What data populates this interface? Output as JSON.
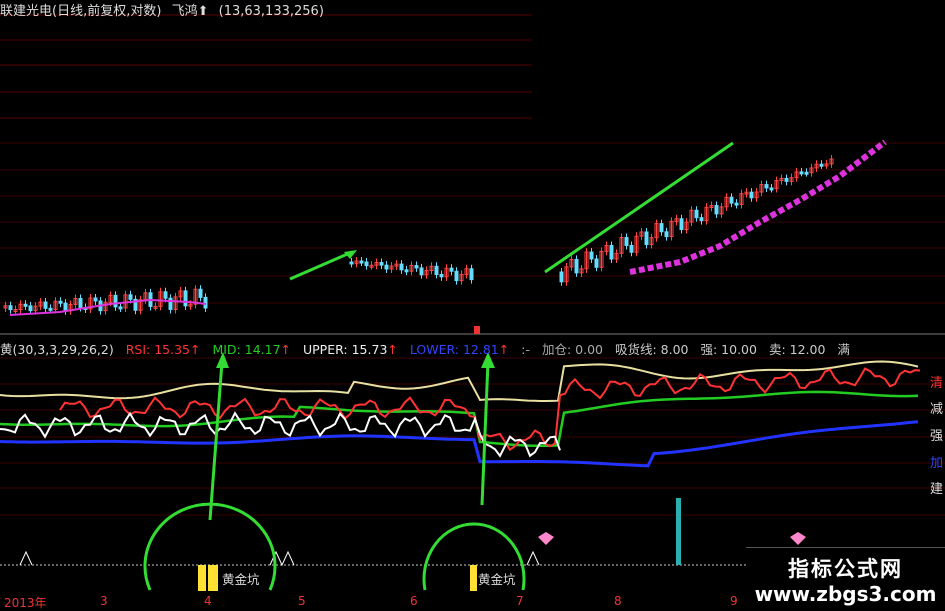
{
  "header": {
    "stock": "联建光电",
    "period": "(日线,前复权,对数)",
    "indicator": "飞鸿",
    "params": "(13,63,133,256)"
  },
  "indicator_bar": {
    "name": "黄",
    "params": "(30,3,3,29,26,2)",
    "rsi": "RSI: 15.35",
    "mid": "MID: 14.17",
    "upper": "UPPER: 15.73",
    "lower": "LOWER: 12.81",
    "jiacang": "加仓: 0.00",
    "xihuoxian": "吸货线: 8.00",
    "qiang": "强: 10.00",
    "mai": "卖: 12.00",
    "edge": "满"
  },
  "side_labels": [
    "清",
    "减",
    "强",
    "加",
    "建"
  ],
  "coin_labels": [
    "黄金坑",
    "黄金坑"
  ],
  "time_axis": [
    "2013年",
    "3",
    "4",
    "5",
    "6",
    "7",
    "8",
    "9"
  ],
  "watermark": {
    "line1": "指标公式网",
    "line2": "www.zbgs3.com"
  },
  "colors": {
    "rsi": "#ff3333",
    "mid": "#22cc22",
    "upper": "#e8e0a0",
    "lower": "#2233ff",
    "white": "#ffffff",
    "ma": "#dd33dd",
    "arrow": "#33dd33",
    "grid": "#5a0000"
  }
}
